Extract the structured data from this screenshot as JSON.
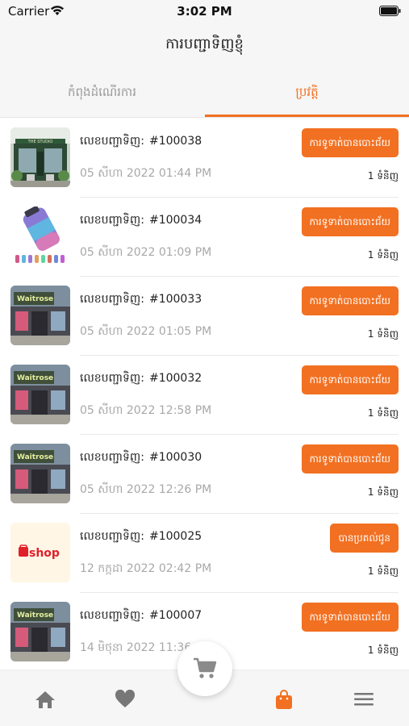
{
  "status_bar": {
    "carrier": "Carrier",
    "time": "3:02 PM"
  },
  "header": {
    "title": "ការបញ្ជាទិញខ្ញុំ"
  },
  "tabs": [
    {
      "label": "កំពុងដំណើរការ",
      "active": false
    },
    {
      "label": "ប្រវត្តិ",
      "active": true
    }
  ],
  "accent_color": "#f27021",
  "orders": [
    {
      "thumb": "storefront-image",
      "label": "លេខបញ្ជាទិញ:",
      "number": "#100038",
      "date": "05 សីហា 2022 01:44 PM",
      "status": "ការទូទាត់បានបោះជ័យ",
      "qty": "1 ទំនិញ"
    },
    {
      "thumb": "water-bottle-image",
      "label": "លេខបញ្ជាទិញ:",
      "number": "#100034",
      "date": "05 សីហា 2022 01:09 PM",
      "status": "ការទូទាត់បានបោះជ័យ",
      "qty": "1 ទំនិញ"
    },
    {
      "thumb": "little-waitrose-image",
      "label": "លេខបញ្ជាទិញ:",
      "number": "#100033",
      "date": "05 សីហា 2022 01:05 PM",
      "status": "ការទូទាត់បានបោះជ័យ",
      "qty": "1 ទំនិញ"
    },
    {
      "thumb": "little-waitrose-image",
      "label": "លេខបញ្ជាទិញ:",
      "number": "#100032",
      "date": "05 សីហា 2022 12:58 PM",
      "status": "ការទូទាត់បានបោះជ័យ",
      "qty": "1 ទំនិញ"
    },
    {
      "thumb": "little-waitrose-image",
      "label": "លេខបញ្ជាទិញ:",
      "number": "#100030",
      "date": "05 សីហា 2022 12:26 PM",
      "status": "ការទូទាត់បានបោះជ័យ",
      "qty": "1 ទំនិញ"
    },
    {
      "thumb": "shop-logo-image",
      "logo_text": "shop",
      "label": "លេខបញ្ជាទិញ:",
      "number": "#100025",
      "date": "12 កក្កដា 2022 02:42 PM",
      "status": "បានប្រគល់ជូន",
      "qty": "1 ទំនិញ"
    },
    {
      "thumb": "little-waitrose-image",
      "label": "លេខបញ្ជាទិញ:",
      "number": "#100007",
      "date": "14 មិថុនា 2022 11:36 AM",
      "status": "ការទូទាត់បានបោះជ័យ",
      "qty": "1 ទំនិញ"
    }
  ],
  "tabbar": {
    "items": [
      "home-icon",
      "heart-icon",
      "cart-icon",
      "bag-icon",
      "menu-icon"
    ],
    "active": "bag-icon"
  }
}
